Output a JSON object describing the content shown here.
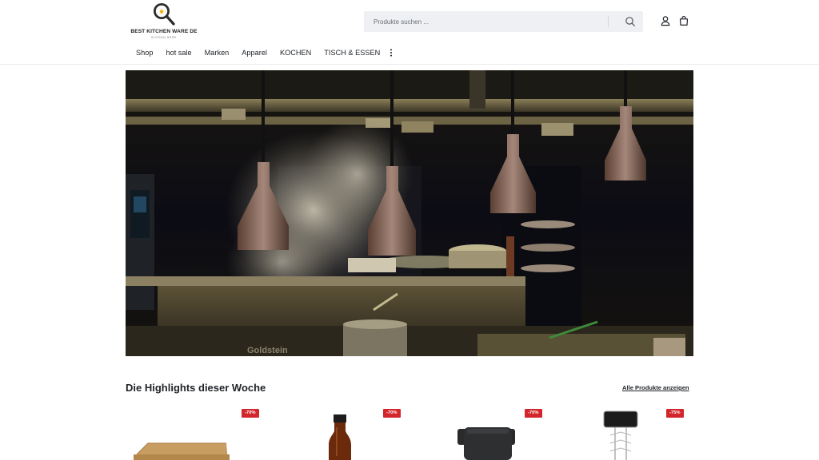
{
  "header": {
    "logo_text": "BEST KITCHEN WARE DE",
    "logo_slogan": "SLOGAN HERE",
    "search": {
      "placeholder": "Produkte suchen ..."
    },
    "icons": [
      "search-icon",
      "user-icon",
      "cart-icon"
    ]
  },
  "nav": {
    "items": [
      {
        "label": "Shop"
      },
      {
        "label": "hot sale"
      },
      {
        "label": "Marken"
      },
      {
        "label": "Apparel"
      },
      {
        "label": "KOCHEN"
      },
      {
        "label": "TISCH & ESSEN"
      }
    ],
    "more_icon": "more-vertical-icon"
  },
  "hero": {
    "image_subject": "professional kitchen with heat lamps and steam",
    "stove_brand_text": "Goldstein"
  },
  "highlights": {
    "title": "Die Highlights dieser Woche",
    "link_label": "Alle Produkte anzeigen",
    "products": [
      {
        "badge": "-70%",
        "image": "wooden cutting board"
      },
      {
        "badge": "-70%",
        "image": "amber glass bottle"
      },
      {
        "badge": "-70%",
        "image": "black pot with handles"
      },
      {
        "badge": "-75%",
        "image": "display stand"
      }
    ]
  },
  "colors": {
    "badge": "#d3262c",
    "search_bg": "#eef0f3",
    "text": "#1f2328"
  }
}
